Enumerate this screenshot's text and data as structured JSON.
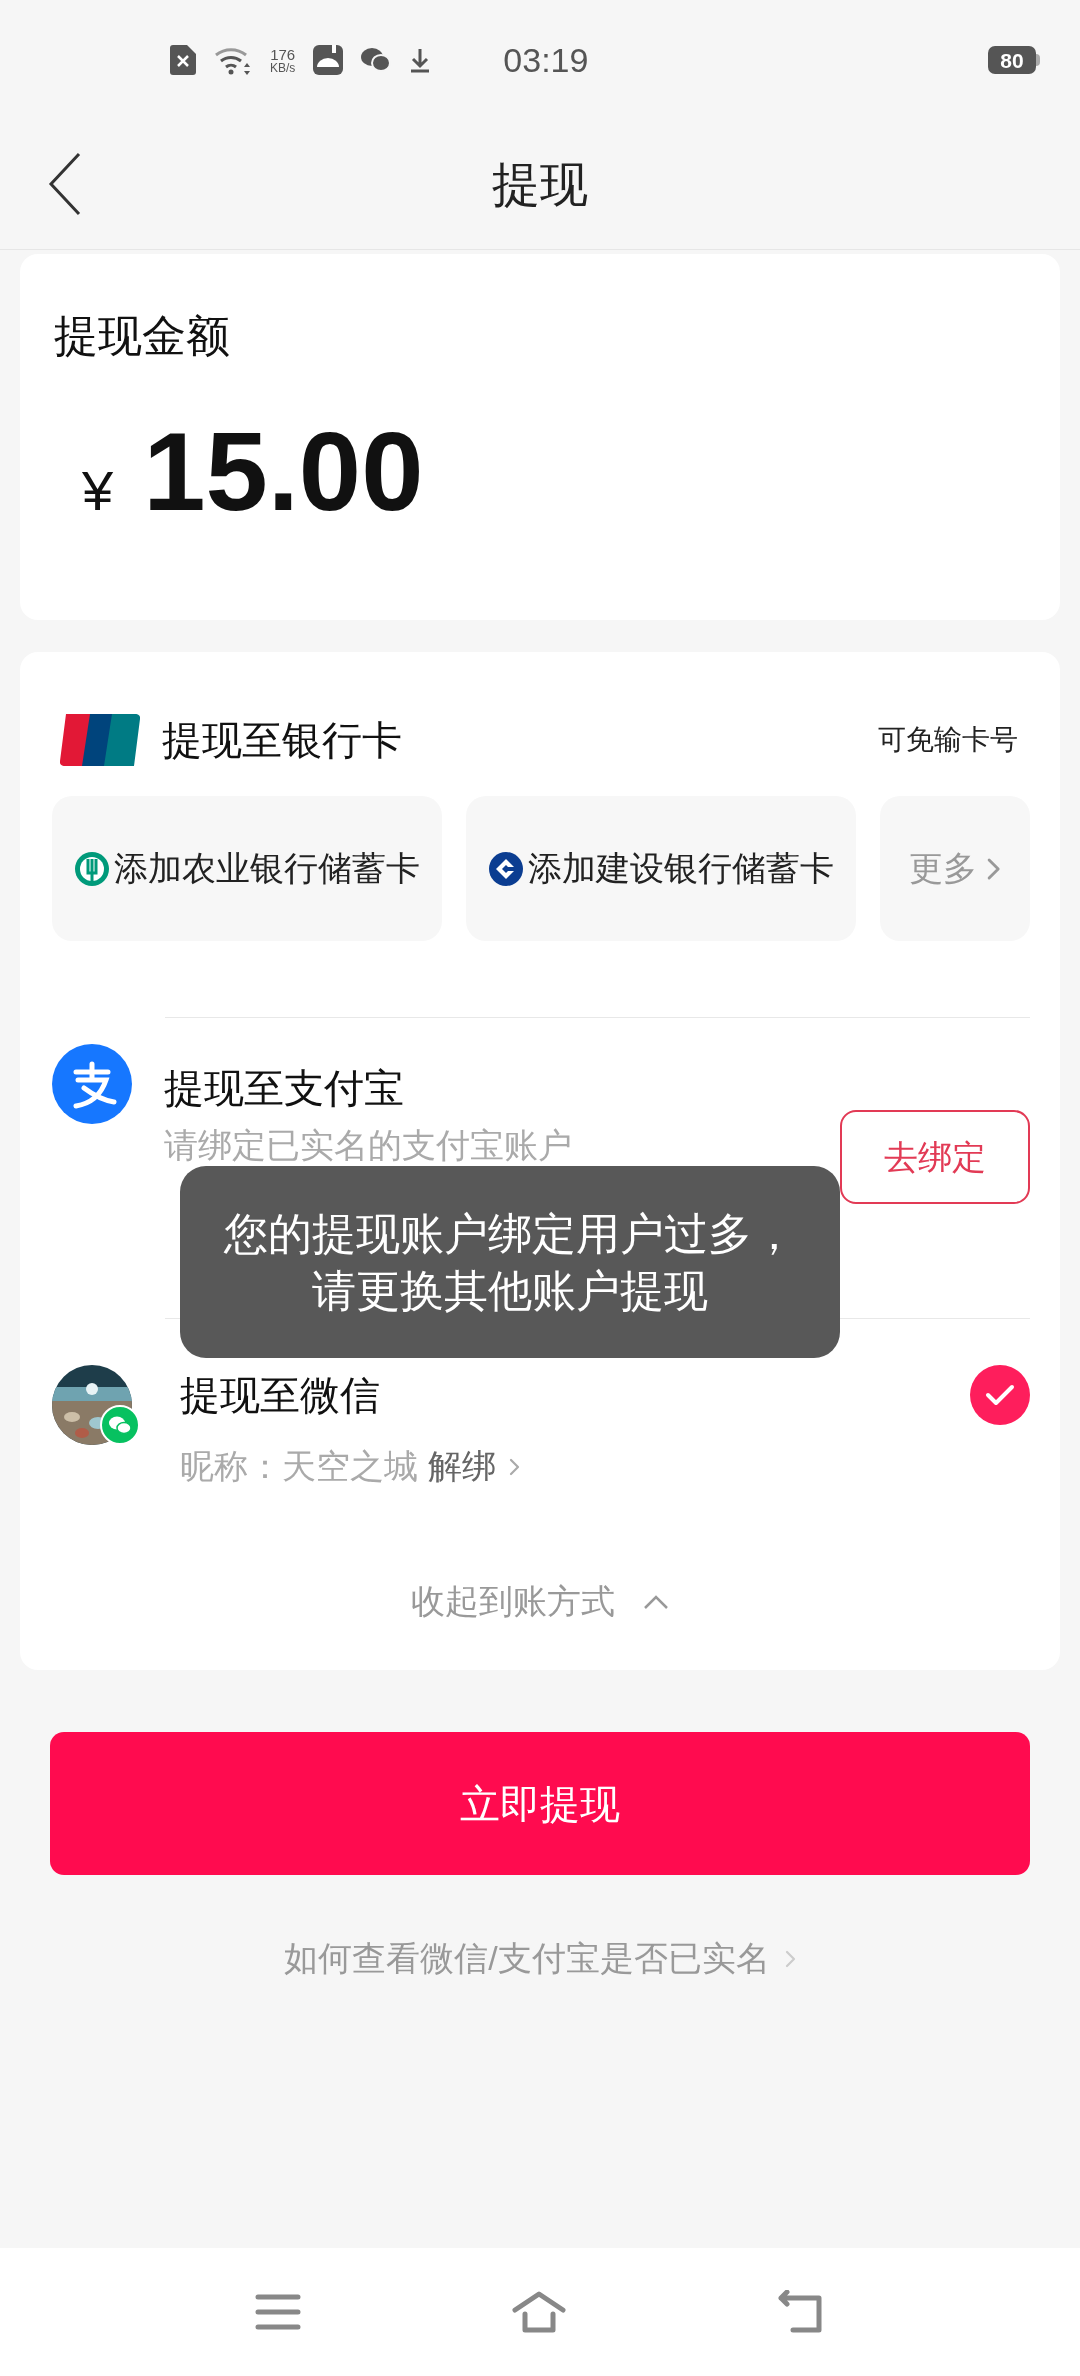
{
  "status_bar": {
    "speed": "176",
    "speed_unit": "KB/s",
    "time": "03:19",
    "battery": "80"
  },
  "header": {
    "title": "提现"
  },
  "amount_card": {
    "label": "提现金额",
    "currency": "¥",
    "amount": "15.00"
  },
  "methods": {
    "bank": {
      "title": "提现至银行卡",
      "note": "可免输卡号",
      "cards": [
        {
          "label": "添加农业银行储蓄卡",
          "kind": "abc"
        },
        {
          "label": "添加建设银行储蓄卡",
          "kind": "ccb"
        }
      ],
      "more": "更多"
    },
    "alipay": {
      "title": "提现至支付宝",
      "subtitle": "请绑定已实名的支付宝账户",
      "button": "去绑定"
    },
    "wechat": {
      "title": "提现至微信",
      "nickname": "昵称：天空之城",
      "unbind": "解绑",
      "selected": true
    },
    "collapse": "收起到账方式"
  },
  "submit": "立即提现",
  "help_link": "如何查看微信/支付宝是否已实名",
  "toast": {
    "lines": [
      "您的提现账户绑定用户过多，",
      "请更换其他账户提现"
    ]
  }
}
